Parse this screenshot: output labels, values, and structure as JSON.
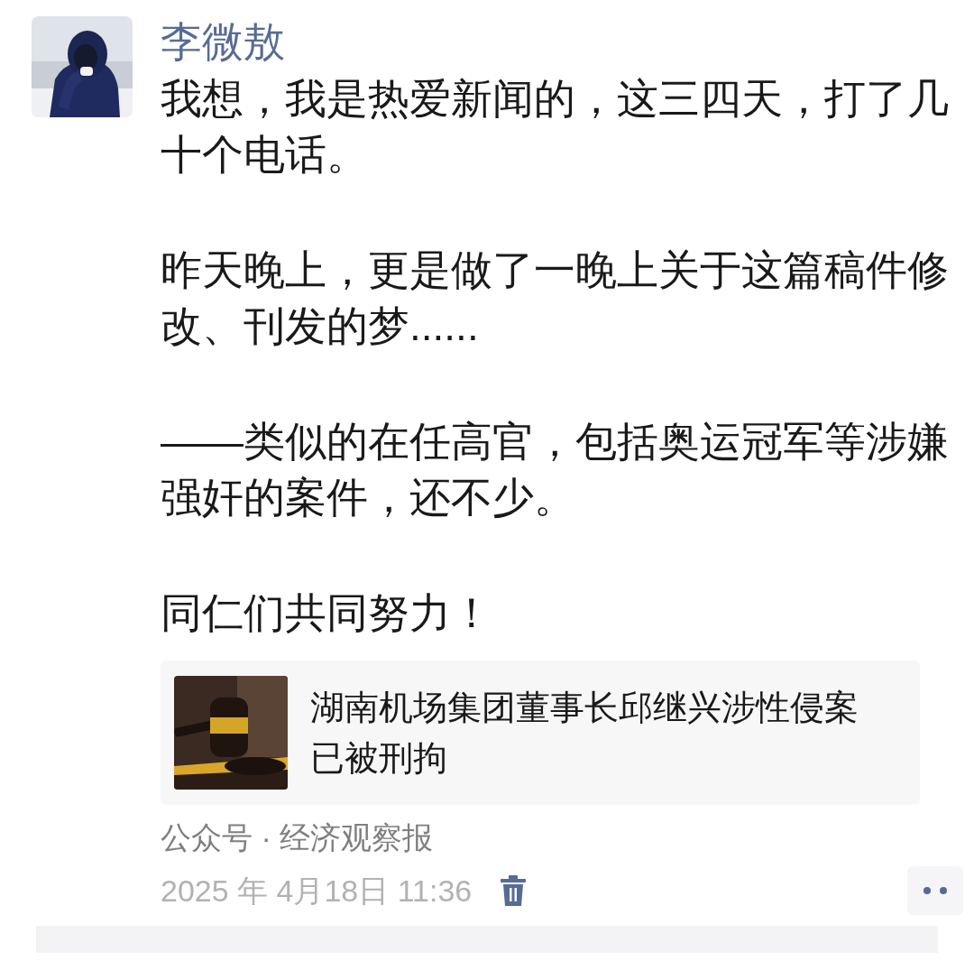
{
  "post": {
    "author": "李微敖",
    "paragraphs": [
      "我想，我是热爱新闻的，这三四天，打了几十个电话。",
      "昨天晚上，更是做了一晚上关于这篇稿件修改、刊发的梦......",
      "——类似的在任高官，包括奥运冠军等涉嫌强奸的案件，还不少。",
      "同仁们共同努力！"
    ],
    "link_card": {
      "kind": "picture",
      "title": "湖南机场集团董事长邱继兴涉性侵案已被刑拘"
    },
    "source": "公众号 · 经济观察报",
    "time": "2025 年 4月18日 11:36",
    "deletable": true
  }
}
